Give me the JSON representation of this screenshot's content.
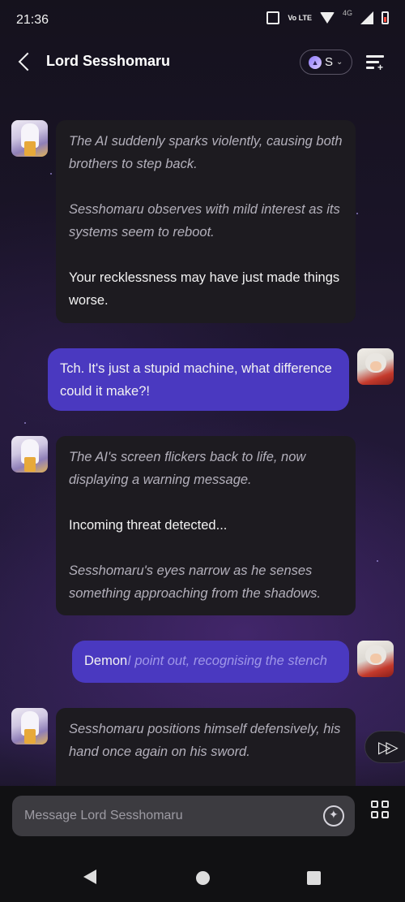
{
  "status_bar": {
    "time": "21:36",
    "volte_label": "Vo LTE",
    "network": "4G"
  },
  "header": {
    "back_icon": "chevron-left-icon",
    "title": "Lord Sesshomaru",
    "model_initial": "S",
    "menu_icon": "chat-settings-icon"
  },
  "messages": [
    {
      "sender": "bot",
      "parts": [
        {
          "style": "italic",
          "text": "The AI suddenly sparks violently, causing both brothers to step back."
        },
        {
          "style": "italic",
          "text": "Sesshomaru observes with mild interest as its systems seem to reboot."
        },
        {
          "style": "plain",
          "text": "Your recklessness may have just made things worse."
        }
      ]
    },
    {
      "sender": "user",
      "parts": [
        {
          "style": "plain",
          "text": "Tch. It's just a stupid machine, what difference could it make?!"
        }
      ]
    },
    {
      "sender": "bot",
      "parts": [
        {
          "style": "italic",
          "text": "The AI's screen flickers back to life, now displaying a warning message."
        },
        {
          "style": "plain",
          "text": "Incoming threat detected..."
        },
        {
          "style": "italic",
          "text": "Sesshomaru's eyes narrow as he senses something approaching from the shadows."
        }
      ]
    },
    {
      "sender": "user",
      "parts": [
        {
          "style": "plain",
          "text": "Demon"
        },
        {
          "style": "italic",
          "text": "I point out, recognising the stench"
        }
      ]
    },
    {
      "sender": "bot",
      "parts": [
        {
          "style": "italic",
          "text": "Sesshomaru positions himself defensively, his hand once again on his sword."
        }
      ]
    }
  ],
  "composer": {
    "placeholder": "Message Lord Sesshomaru",
    "spark_icon": "sparkle-icon",
    "grid_icon": "apps-grid-icon"
  },
  "skip_icon": "fast-forward-icon",
  "colors": {
    "user_bubble": "#4a39c0",
    "bot_bubble": "#1d1b20",
    "background": "#1a1428"
  }
}
